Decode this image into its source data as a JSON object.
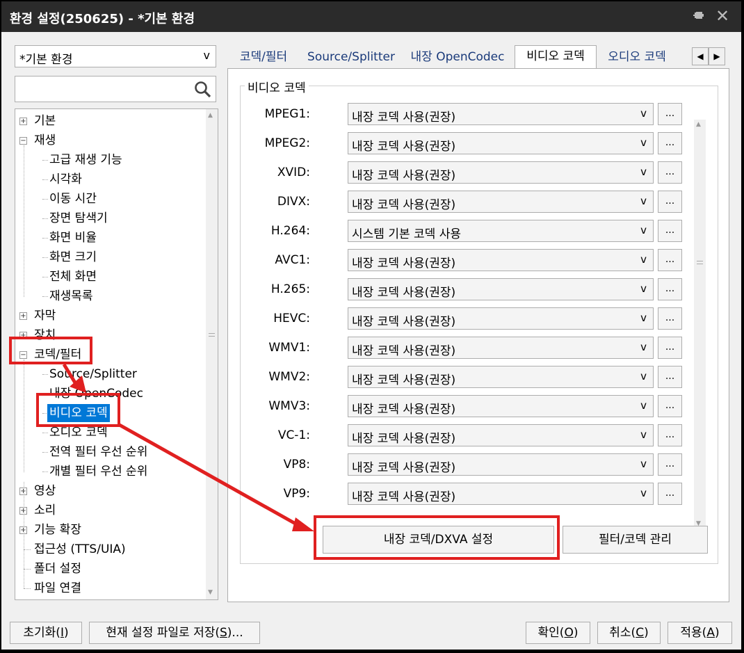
{
  "window": {
    "title": "환경 설정(250625) - *기본 환경"
  },
  "profile": {
    "selected": "*기본 환경",
    "arrow": "v"
  },
  "search": {
    "value": ""
  },
  "tree": {
    "items": [
      {
        "label": "기본",
        "level": 0,
        "expander": "+"
      },
      {
        "label": "재생",
        "level": 0,
        "expander": "-"
      },
      {
        "label": "고급 재생 기능",
        "level": 1
      },
      {
        "label": "시각화",
        "level": 1
      },
      {
        "label": "이동 시간",
        "level": 1
      },
      {
        "label": "장면 탐색기",
        "level": 1
      },
      {
        "label": "화면 비율",
        "level": 1
      },
      {
        "label": "화면 크기",
        "level": 1
      },
      {
        "label": "전체 화면",
        "level": 1
      },
      {
        "label": "재생목록",
        "level": 1
      },
      {
        "label": "자막",
        "level": 0,
        "expander": "+"
      },
      {
        "label": "장치",
        "level": 0,
        "expander": "+"
      },
      {
        "label": "코덱/필터",
        "level": 0,
        "expander": "-"
      },
      {
        "label": "Source/Splitter",
        "level": 1
      },
      {
        "label": "내장 OpenCodec",
        "level": 1
      },
      {
        "label": "비디오 코덱",
        "level": 1,
        "selected": true
      },
      {
        "label": "오디오 코덱",
        "level": 1
      },
      {
        "label": "전역 필터 우선 순위",
        "level": 1
      },
      {
        "label": "개별 필터 우선 순위",
        "level": 1
      },
      {
        "label": "영상",
        "level": 0,
        "expander": "+"
      },
      {
        "label": "소리",
        "level": 0,
        "expander": "+"
      },
      {
        "label": "기능 확장",
        "level": 0,
        "expander": "+"
      },
      {
        "label": "접근성 (TTS/UIA)",
        "level": 0
      },
      {
        "label": "폴더 설정",
        "level": 0
      },
      {
        "label": "파일 연결",
        "level": 0
      }
    ]
  },
  "tabs": {
    "items": [
      "코덱/필터",
      "Source/Splitter",
      "내장 OpenCodec",
      "비디오 코덱",
      "오디오 코덱"
    ],
    "active": "비디오 코덱",
    "prev": "◀",
    "next": "▶"
  },
  "video_codec": {
    "group_title": "비디오 코덱",
    "rows": [
      {
        "label": "MPEG1:",
        "value": "내장 코덱 사용(권장)"
      },
      {
        "label": "MPEG2:",
        "value": "내장 코덱 사용(권장)"
      },
      {
        "label": "XVID:",
        "value": "내장 코덱 사용(권장)"
      },
      {
        "label": "DIVX:",
        "value": "내장 코덱 사용(권장)"
      },
      {
        "label": "H.264:",
        "value": "시스템 기본 코덱 사용"
      },
      {
        "label": "AVC1:",
        "value": "내장 코덱 사용(권장)"
      },
      {
        "label": "H.265:",
        "value": "내장 코덱 사용(권장)"
      },
      {
        "label": "HEVC:",
        "value": "내장 코덱 사용(권장)"
      },
      {
        "label": "WMV1:",
        "value": "내장 코덱 사용(권장)"
      },
      {
        "label": "WMV2:",
        "value": "내장 코덱 사용(권장)"
      },
      {
        "label": "WMV3:",
        "value": "내장 코덱 사용(권장)"
      },
      {
        "label": "VC-1:",
        "value": "내장 코덱 사용(권장)"
      },
      {
        "label": "VP8:",
        "value": "내장 코덱 사용(권장)"
      },
      {
        "label": "VP9:",
        "value": "내장 코덱 사용(권장)"
      }
    ],
    "dropdown_arrow": "v",
    "more_label": "..."
  },
  "panel_buttons": {
    "dxva": "내장 코덱/DXVA 설정",
    "filter_manage": "필터/코덱 관리"
  },
  "footer": {
    "reset": "초기화(",
    "reset_key": "I",
    "save": "현재 설정 파일로 저장(",
    "save_key": "S",
    "save_suffix": ")...",
    "ok": "확인(",
    "ok_key": "O",
    "cancel": "취소(",
    "cancel_key": "C",
    "apply": "적용(",
    "apply_key": "A",
    "close_paren": ")"
  },
  "annotation": {
    "highlight_color": "#e02020"
  },
  "icons": {
    "pin": "pin-icon",
    "close": "close-icon",
    "search": "search-icon"
  }
}
